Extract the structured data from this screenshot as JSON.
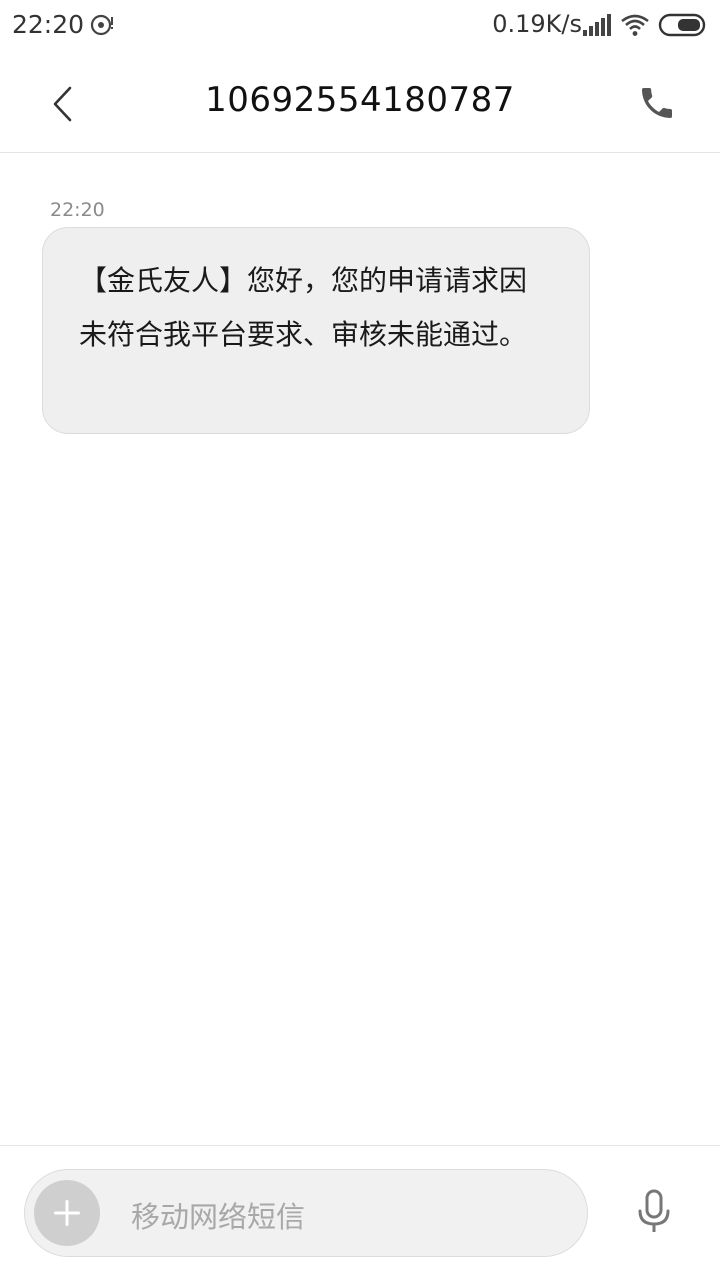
{
  "status_bar": {
    "time": "22:20",
    "network_speed": "0.19K/s",
    "icons": [
      "disc-icon",
      "signal-icon",
      "wifi-icon",
      "battery-icon"
    ]
  },
  "header": {
    "title": "10692554180787",
    "back_icon": "chevron-left-icon",
    "call_icon": "phone-icon"
  },
  "conversation": {
    "messages": [
      {
        "time": "22:20",
        "text": "【金氏友人】您好，您的申请请求因未符合我平台要求、审核未能通过。"
      }
    ]
  },
  "composer": {
    "placeholder": "移动网络短信",
    "add_icon": "plus-icon",
    "voice_icon": "microphone-icon"
  },
  "colors": {
    "background": "#ffffff",
    "bubble": "#efefef",
    "bubble_border": "#dcdcdc",
    "muted_text": "#8a8a8a",
    "add_button": "#cfcfcf"
  }
}
